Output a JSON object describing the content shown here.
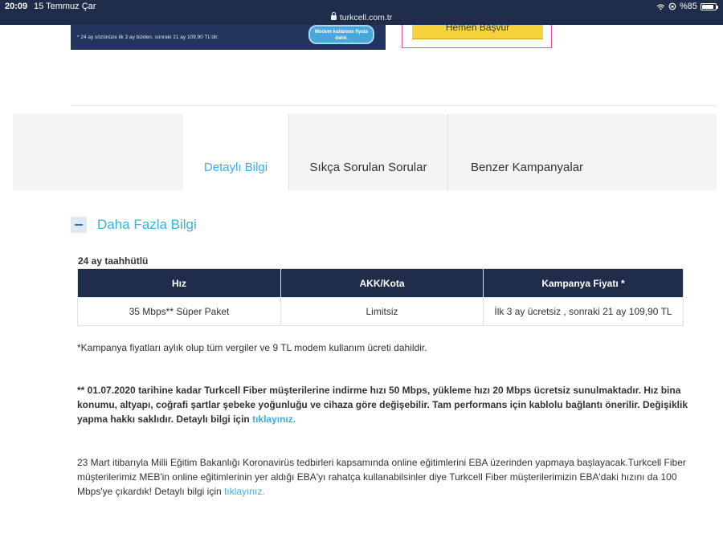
{
  "status_bar": {
    "time": "20:09",
    "date": "15 Temmuz Çar",
    "url": "turkcell.com.tr",
    "battery": "%85",
    "battery_level": 0.85
  },
  "banner": {
    "text": "* 24 ay sözünüze ilk 3 ay bizden, sonraki 21 ay 109,90 TL'dir.",
    "pill": "Modem kullanımı fiyata dahil.",
    "apply_button": "Hemen Başvur"
  },
  "tabs": [
    {
      "label": "Detaylı Bilgi",
      "active": true
    },
    {
      "label": "Sıkça Sorulan Sorular",
      "active": false
    },
    {
      "label": "Benzer Kampanyalar",
      "active": false
    }
  ],
  "accordion": {
    "title": "Daha Fazla Bilgi"
  },
  "table": {
    "caption": "24 ay taahhütlü",
    "headers": [
      "Hız",
      "AKK/Kota",
      "Kampanya Fiyatı *"
    ],
    "rows": [
      [
        "35 Mbps** Süper Paket",
        "Limitsiz",
        "İlk 3 ay ücretsiz , sonraki 21 ay 109,90 TL"
      ]
    ]
  },
  "notes": {
    "footnote": "*Kampanya fiyatları aylık olup tüm vergiler ve 9 TL modem kullanım ücreti dahildir.",
    "speed_note": "** 01.07.2020 tarihine kadar Turkcell Fiber müşterilerine indirme hızı 50 Mbps, yükleme hızı 20 Mbps ücretsiz sunulmaktadır. Hız bina konumu, altyapı, coğrafi şartlar şebeke yoğunluğu ve cihaza göre değişebilir. Tam performans için kablolu bağlantı önerilir. Değişiklik yapma hakkı saklıdır. Detaylı bilgi için ",
    "speed_note_link": "tıklayınız.",
    "eba_note": "23 Mart itibarıyla Milli Eğitim Bakanlığı Koronavirüs tedbirleri kapsamında online eğitimlerini EBA üzerinden yapmaya başlayacak.Turkcell Fiber müşterilerimiz MEB'in online eğitimlerinin yer aldığı EBA'yı rahatça kullanabilsinler diye Turkcell Fiber müşterilerimizin EBA'daki hızını da 100 Mbps'ye çıkardık! Detaylı bilgi için ",
    "eba_note_link": "tıklayınız."
  },
  "colors": {
    "navy": "#1f2d4a",
    "accent_blue": "#3eaee0",
    "apply_yellow": "#f6d33a"
  }
}
